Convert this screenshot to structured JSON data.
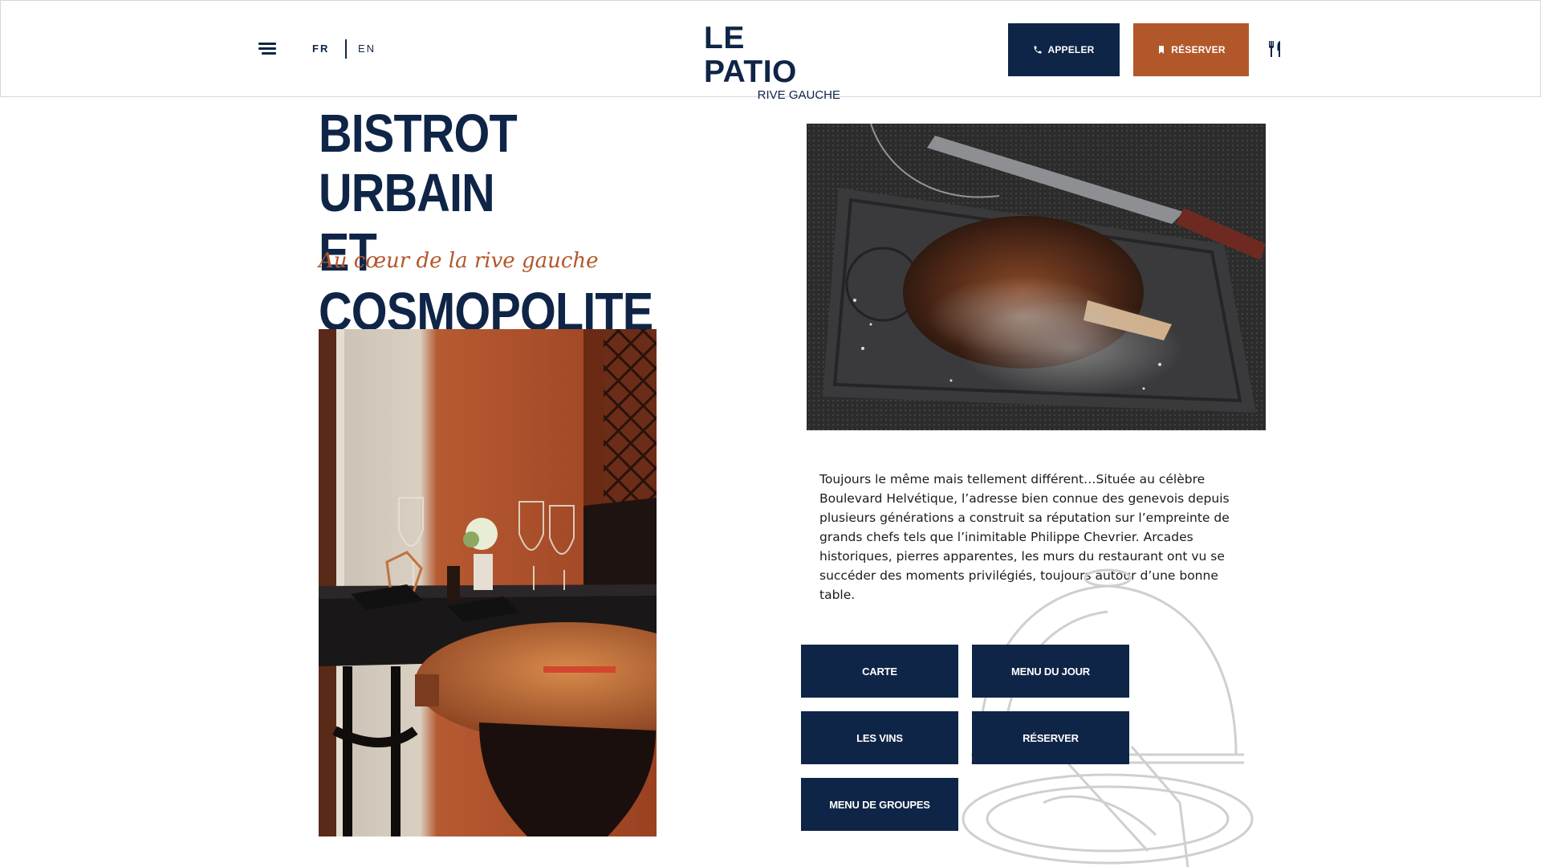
{
  "header": {
    "languages": [
      "FR",
      "EN"
    ],
    "active_language": "FR",
    "logo_main": "LE PATIO",
    "logo_sub": "RIVE GAUCHE",
    "call_label": "APPELER",
    "reserve_label": "RÉSERVER"
  },
  "main": {
    "headline_line1": "BISTROT URBAIN",
    "headline_line2": "ET COSMOPOLITE",
    "tagline": "Au cœur de la rive gauche",
    "description": "Toujours le même mais tellement différent…Située au célèbre Boulevard Helvétique, l’adresse bien connue des genevois depuis plusieurs générations a construit sa réputation sur l’empreinte de grands chefs tels que l’inimitable Philippe Chevrier. Arcades historiques, pierres apparentes, les murs du restaurant ont vu se succéder des moments privilégiés, toujours autour d’une bonne table.",
    "buttons": [
      "CARTE",
      "MENU DU JOUR",
      "LES VINS",
      "RÉSERVER",
      "MENU DE GROUPES"
    ]
  },
  "colors": {
    "navy": "#0f2547",
    "rust": "#b2572a"
  },
  "icons": [
    "menu-icon",
    "phone-icon",
    "bookmark-icon",
    "cutlery-icon"
  ]
}
